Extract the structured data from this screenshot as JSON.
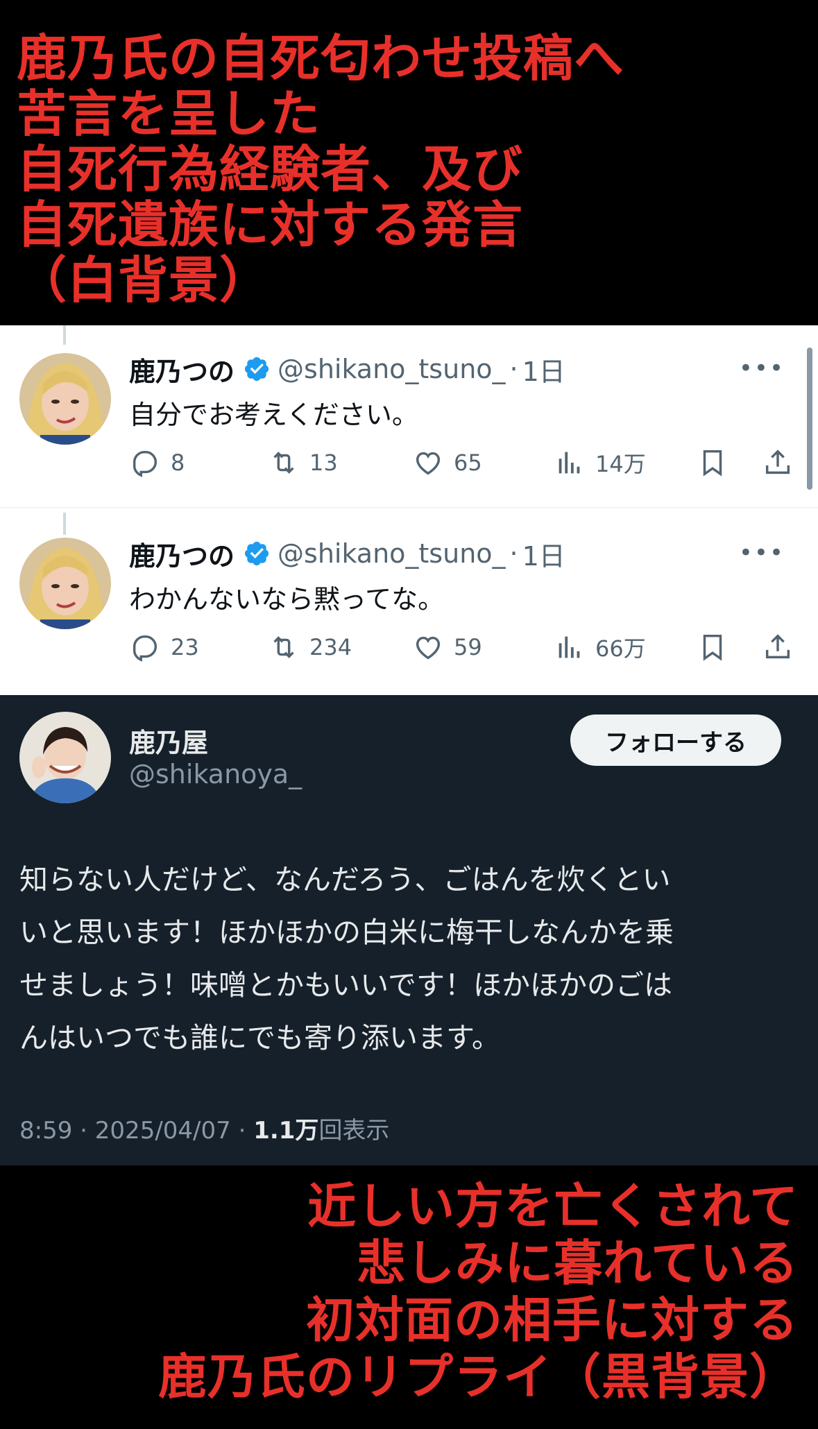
{
  "top_caption": {
    "lines": [
      "鹿乃氏の自死匂わせ投稿へ",
      "苦言を呈した",
      "自死行為経験者、及び",
      "自死遺族に対する発言",
      "（白背景）"
    ],
    "color": "#e8302a"
  },
  "tweets": [
    {
      "name": "鹿乃つの",
      "handle": "@shikano_tsuno_",
      "dot": "·",
      "time": "1日",
      "text": "自分でお考えください。",
      "reply_count": "8",
      "retweet_count": "13",
      "like_count": "65",
      "view_count": "14万"
    },
    {
      "name": "鹿乃つの",
      "handle": "@shikano_tsuno_",
      "dot": "·",
      "time": "1日",
      "text": "わかんないなら黙ってな。",
      "reply_count": "23",
      "retweet_count": "234",
      "like_count": "59",
      "view_count": "66万"
    }
  ],
  "more_label": "•••",
  "dark_tweet": {
    "name": "鹿乃屋",
    "handle": "@shikanoya_",
    "follow_label": "フォローする",
    "body_lines": [
      "知らない人だけど、なんだろう、ごはんを炊くとい",
      "いと思います！ほかほかの白米に梅干しなんかを乗",
      "せましょう！味噌とかもいいです！ほかほかのごは",
      "んはいつでも誰にでも寄り添います。"
    ],
    "time": "8:59",
    "date": "2025/04/07",
    "views_value": "1.1万",
    "views_suffix": "回表示",
    "sep": "·"
  },
  "bottom_caption": {
    "lines": [
      "近しい方を亡くされて",
      "悲しみに暮れている",
      "初対面の相手に対する",
      "鹿乃氏のリプライ（黒背景）"
    ],
    "color": "#e8302a"
  },
  "icons": [
    "reply-icon",
    "retweet-icon",
    "like-icon",
    "views-icon",
    "bookmark-icon",
    "share-icon",
    "verified-icon",
    "more-icon"
  ],
  "colors": {
    "verified": "#1d9bf0",
    "dark_bg": "#15202b",
    "light_bg": "#ffffff",
    "muted": "#536471"
  }
}
